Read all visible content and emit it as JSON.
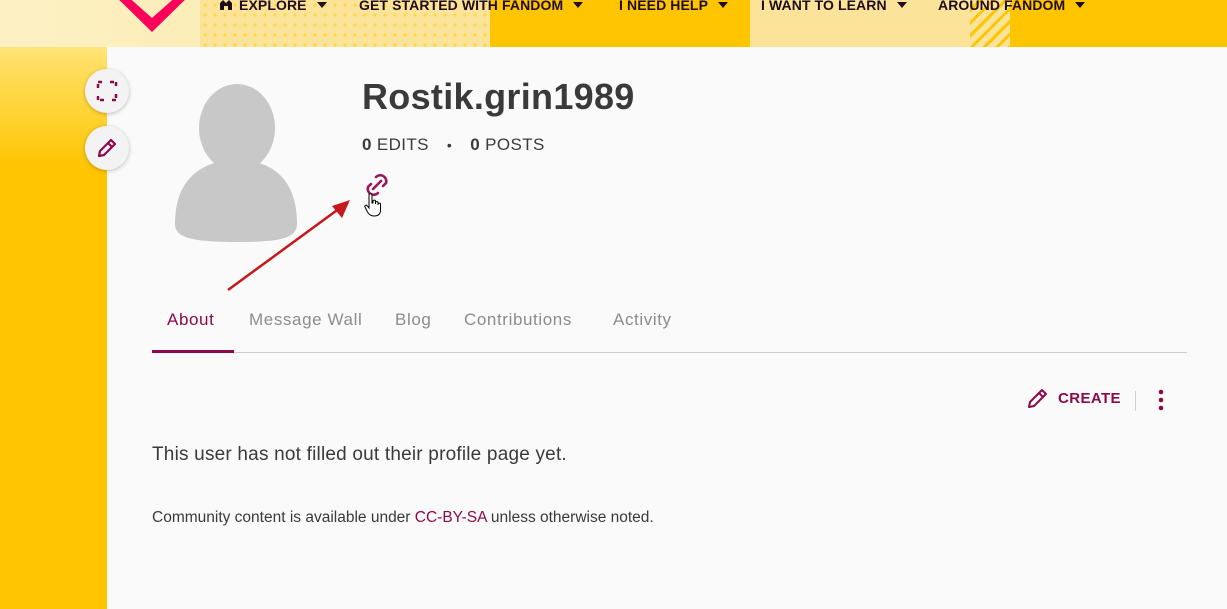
{
  "nav": {
    "items": [
      {
        "label": "EXPLORE",
        "icon": "fandom-heart-icon"
      },
      {
        "label": "GET STARTED WITH FANDOM"
      },
      {
        "label": "I NEED HELP"
      },
      {
        "label": "I WANT TO LEARN"
      },
      {
        "label": "AROUND FANDOM"
      }
    ]
  },
  "profile": {
    "username": "Rostik.grin1989",
    "edits_count": "0",
    "edits_label": "EDITS",
    "separator": "•",
    "posts_count": "0",
    "posts_label": "POSTS"
  },
  "tabs": [
    {
      "label": "About",
      "active": true
    },
    {
      "label": "Message Wall"
    },
    {
      "label": "Blog"
    },
    {
      "label": "Contributions"
    },
    {
      "label": "Activity"
    }
  ],
  "toolbar": {
    "create_label": "CREATE"
  },
  "content": {
    "empty_message": "This user has not filled out their profile page yet.",
    "license_prefix": "Community content is available under ",
    "license_link": "CC-BY-SA",
    "license_suffix": " unless otherwise noted."
  },
  "colors": {
    "accent": "#8c0a4a",
    "brand_yellow": "#ffc500",
    "annotation_arrow": "#c8161d"
  }
}
